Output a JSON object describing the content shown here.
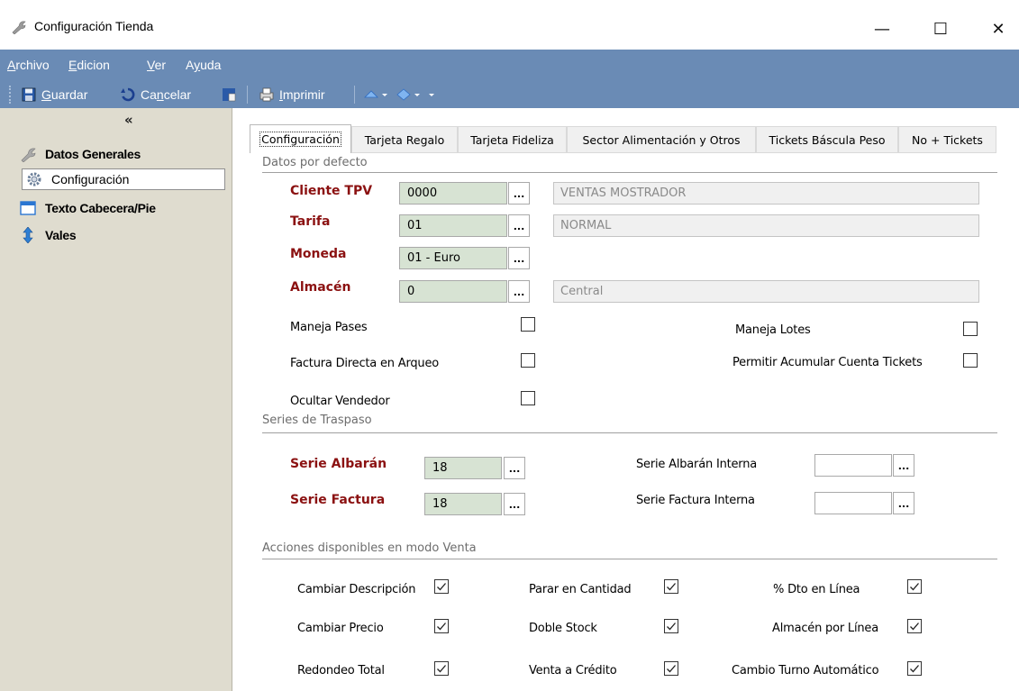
{
  "window": {
    "title": "Configuración Tienda",
    "minimize": "—",
    "maximize": "☐",
    "close": "✕"
  },
  "menu": {
    "items": [
      {
        "accel": "A",
        "rest": "rchivo"
      },
      {
        "accel": "E",
        "rest": "dicion"
      },
      {
        "accel": "V",
        "rest": "er"
      },
      {
        "pre": "A",
        "accel": "y",
        "rest": "uda"
      }
    ]
  },
  "toolbar": {
    "save_accel": "G",
    "save_rest": "uardar",
    "cancel_pre": "Ca",
    "cancel_accel": "n",
    "cancel_rest": "celar",
    "print_accel": "I",
    "print_rest": "mprimir"
  },
  "nav": {
    "collapse": "«",
    "items": [
      {
        "label": "Datos Generales"
      },
      {
        "label": "Configuración"
      },
      {
        "label": "Texto Cabecera/Pie"
      },
      {
        "label": "Vales"
      }
    ]
  },
  "tabs": [
    {
      "label": "Configuración"
    },
    {
      "label": "Tarjeta Regalo"
    },
    {
      "label": "Tarjeta Fideliza"
    },
    {
      "label": "Sector Alimentación y Otros"
    },
    {
      "label": "Tickets Báscula Peso"
    },
    {
      "label": "No + Tickets"
    }
  ],
  "groups": {
    "defaults": "Datos por defecto",
    "series": "Series de Traspaso",
    "actions": "Acciones disponibles en modo Venta"
  },
  "fields": {
    "cliente": {
      "label": "Cliente TPV",
      "code": "0000",
      "desc": "VENTAS MOSTRADOR"
    },
    "tarifa": {
      "label": "Tarifa",
      "code": "01",
      "desc": "NORMAL"
    },
    "moneda": {
      "label": "Moneda",
      "code": "01 - Euro"
    },
    "almacen": {
      "label": "Almacén",
      "code": "0",
      "desc": "Central"
    },
    "dots": "..."
  },
  "options": {
    "maneja_pases": {
      "label": "Maneja Pases",
      "checked": false
    },
    "factura_directa": {
      "label": "Factura Directa en Arqueo",
      "checked": false
    },
    "ocultar_vendedor": {
      "label": "Ocultar Vendedor",
      "checked": false
    },
    "maneja_lotes": {
      "label": "Maneja Lotes",
      "checked": false
    },
    "permitir_acumular": {
      "label": "Permitir Acumular Cuenta Tickets",
      "checked": false
    }
  },
  "series": {
    "albaran": {
      "label": "Serie Albarán",
      "code": "18"
    },
    "factura": {
      "label": "Serie Factura",
      "code": "18"
    },
    "albaran_interna": {
      "label": "Serie Albarán Interna",
      "code": ""
    },
    "factura_interna": {
      "label": "Serie Factura Interna",
      "code": ""
    }
  },
  "actions": {
    "cambiar_descripcion": {
      "label": "Cambiar Descripción",
      "checked": true
    },
    "cambiar_precio": {
      "label": "Cambiar Precio",
      "checked": true
    },
    "redondeo_total": {
      "label": "Redondeo Total",
      "checked": true
    },
    "parar_cantidad": {
      "label": "Parar en Cantidad",
      "checked": true
    },
    "doble_stock": {
      "label": "Doble Stock",
      "checked": true
    },
    "venta_credito": {
      "label": "Venta a Crédito",
      "checked": true
    },
    "dto_linea": {
      "label": "% Dto en Línea",
      "checked": true
    },
    "almacen_linea": {
      "label": "Almacén por Línea",
      "checked": true
    },
    "cambio_turno": {
      "label": "Cambio Turno Automático",
      "checked": true
    }
  },
  "colors": {
    "menubar": "#6a8bb5",
    "nav_bg": "#dfdccf",
    "required_label": "#8b1111",
    "code_field": "#d7e3d3"
  }
}
